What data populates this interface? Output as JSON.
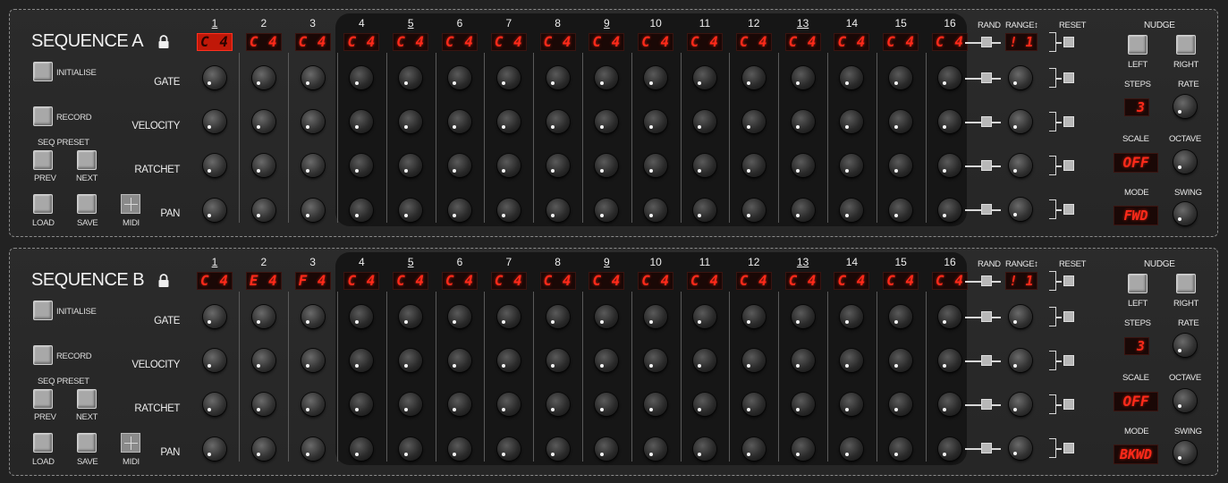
{
  "steps": [
    "1",
    "2",
    "3",
    "4",
    "5",
    "6",
    "7",
    "8",
    "9",
    "10",
    "11",
    "12",
    "13",
    "14",
    "15",
    "16"
  ],
  "underlined_steps": [
    1,
    5,
    9,
    13
  ],
  "labels": {
    "initialise": "INITIALISE",
    "record": "RECORD",
    "seq_preset": "SEQ PRESET",
    "prev": "PREV",
    "next": "NEXT",
    "load": "LOAD",
    "save": "SAVE",
    "midi": "MIDI",
    "gate": "GATE",
    "velocity": "VELOCITY",
    "ratchet": "RATCHET",
    "pan": "PAN",
    "rand": "RAND",
    "range": "RANGE↕",
    "reset": "RESET",
    "nudge": "NUDGE",
    "left": "LEFT",
    "right": "RIGHT",
    "steps": "STEPS",
    "rate": "RATE",
    "scale": "SCALE",
    "octave": "OCTAVE",
    "mode": "MODE",
    "swing": "SWING"
  },
  "sequences": [
    {
      "title": "SEQUENCE A",
      "notes": [
        "C 4",
        "C 4",
        "C 4",
        "C 4",
        "C 4",
        "C 4",
        "C 4",
        "C 4",
        "C 4",
        "C 4",
        "C 4",
        "C 4",
        "C 4",
        "C 4",
        "C 4",
        "C 4"
      ],
      "selected_note": 0,
      "range_value": "! 1",
      "steps_value": "3",
      "scale_value": "OFF",
      "mode_value": "FWD"
    },
    {
      "title": "SEQUENCE B",
      "notes": [
        "C 4",
        "E 4",
        "F 4",
        "C 4",
        "C 4",
        "C 4",
        "C 4",
        "C 4",
        "C 4",
        "C 4",
        "C 4",
        "C 4",
        "C 4",
        "C 4",
        "C 4",
        "C 4"
      ],
      "selected_note": -1,
      "range_value": "! 1",
      "steps_value": "3",
      "scale_value": "OFF",
      "mode_value": "BKWD"
    }
  ],
  "colors": {
    "led_red": "#ff2a1a",
    "panel": "#2b2b2b",
    "step_region": "#161616"
  }
}
